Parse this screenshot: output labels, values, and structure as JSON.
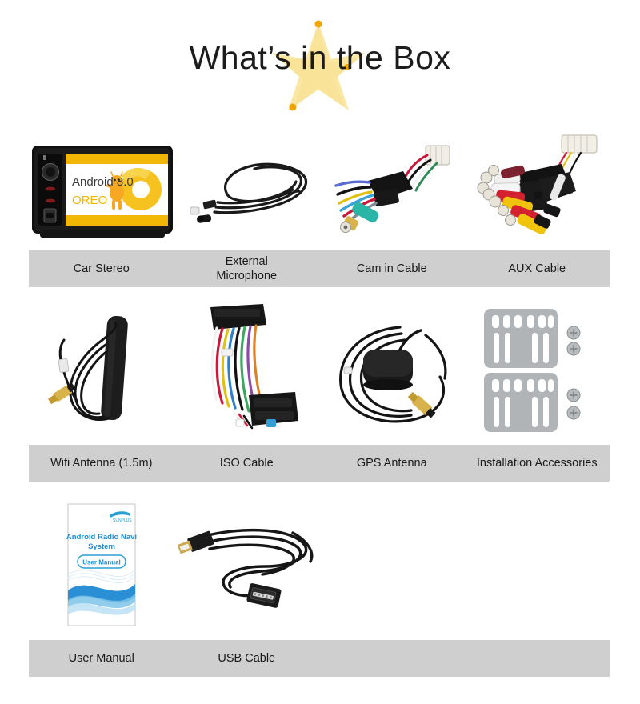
{
  "header": {
    "title": "What’s in the Box",
    "star_icon": "star-burst-icon",
    "star_color": "#f5d76e",
    "star_dot_color": "#f0a500"
  },
  "theme": {
    "background": "#ffffff",
    "label_bar_bg": "#cfcfcf",
    "label_text": "#1a1a1a",
    "title_text": "#1c1c1c",
    "accent_yellow": "#f2b705",
    "bracket_gray": "#b0b4b7"
  },
  "device_screen": {
    "os_label": "Android 8.0",
    "release_label": "OREO",
    "os_text_color": "#3c3c3c",
    "release_text_color": "#f2b705",
    "logo_icon": "android-oreo-logo-icon",
    "band_color": "#f2b705"
  },
  "manual_cover": {
    "brand": "",
    "title_line1": "Android Radio Navi",
    "title_line2": "System",
    "badge": "User Manual",
    "title_color": "#1f8ed6",
    "wave_color": "#2a8fd4"
  },
  "rows": [
    {
      "items": [
        {
          "label": "Car Stereo",
          "icon": "car-stereo-icon"
        },
        {
          "label": "External\nMicrophone",
          "icon": "external-microphone-icon"
        },
        {
          "label": "Cam in Cable",
          "icon": "cam-in-cable-icon"
        },
        {
          "label": "AUX Cable",
          "icon": "aux-cable-icon"
        }
      ]
    },
    {
      "items": [
        {
          "label": "Wifi Antenna (1.5m)",
          "icon": "wifi-antenna-icon"
        },
        {
          "label": "ISO Cable",
          "icon": "iso-cable-icon"
        },
        {
          "label": "GPS Antenna",
          "icon": "gps-antenna-icon"
        },
        {
          "label": "Installation Accessories",
          "icon": "installation-accessories-icon"
        }
      ]
    },
    {
      "items": [
        {
          "label": "User Manual",
          "icon": "user-manual-icon"
        },
        {
          "label": "USB Cable",
          "icon": "usb-cable-icon"
        },
        {
          "label": "",
          "icon": ""
        },
        {
          "label": "",
          "icon": ""
        }
      ]
    }
  ]
}
